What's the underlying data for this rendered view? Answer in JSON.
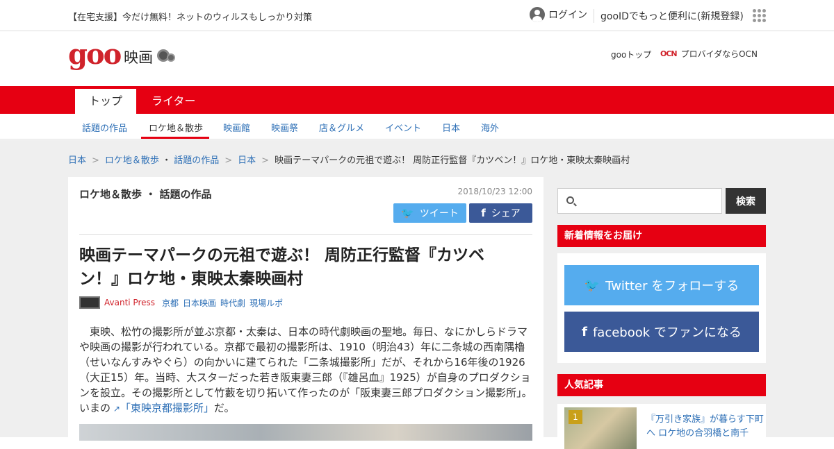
{
  "topbar": {
    "promo": "【在宅支援】今だけ無料！ネットのウィルスもしっかり対策",
    "login": "ログイン",
    "register": "gooIDでもっと便利に(新規登録)"
  },
  "header": {
    "logo": "goo",
    "logo_sub": "映画",
    "goo_top": "gooトップ",
    "ocn_mark": "OCN",
    "ocn": "プロバイダならOCN"
  },
  "tabs": {
    "top": "トップ",
    "writer": "ライター"
  },
  "subnav": [
    "話題の作品",
    "ロケ地＆散歩",
    "映画館",
    "映画祭",
    "店＆グルメ",
    "イベント",
    "日本",
    "海外"
  ],
  "breadcrumb": {
    "items": [
      "日本",
      "ロケ地＆散歩",
      "・",
      "話題の作品",
      "日本"
    ],
    "current": "映画テーマパークの元祖で遊ぶ！ 周防正行監督『カツベン！』ロケ地・東映太秦映画村"
  },
  "article": {
    "category": "ロケ地＆散歩 ・ 話題の作品",
    "date": "2018/10/23 12:00",
    "tweet": "ツイート",
    "share": "シェア",
    "title": "映画テーマパークの元祖で遊ぶ！ 周防正行監督『カツベン！』ロケ地・東映太秦映画村",
    "author": "Avanti Press",
    "tags": [
      "京都",
      "日本映画",
      "時代劇",
      "現場ルポ"
    ],
    "body_main": "東映、松竹の撮影所が並ぶ京都・太秦は、日本の時代劇映画の聖地。毎日、なにかしらドラマや映画の撮影が行われている。京都で最初の撮影所は、1910（明治43）年に二条城の西南隅櫓（せいなんすみやぐら）の向かいに建てられた「二条城撮影所」だが、それから16年後の1926（大正15）年。当時、大スターだった若き阪東妻三郎（『雄呂血』1925）が自身のプロダクションを設立。その撮影所として竹藪を切り拓いて作ったのが「阪東妻三郎プロダクション撮影所」。いまの",
    "body_link": "「東映京都撮影所」",
    "body_end": "だ。"
  },
  "sidebar": {
    "search_button": "検索",
    "news_heading": "新着情報をお届け",
    "twitter_follow": "Twitter をフォローする",
    "facebook_fan": "facebook でファンになる",
    "popular_heading": "人気記事",
    "popular_rank": "1",
    "popular_title": "『万引き家族』が暮らす下町へ ロケ地の合羽橋と南千"
  },
  "colors": {
    "brand_red": "#e60012",
    "twitter_blue": "#55acee",
    "facebook_blue": "#3b5998",
    "link_blue": "#2d6fb6"
  }
}
